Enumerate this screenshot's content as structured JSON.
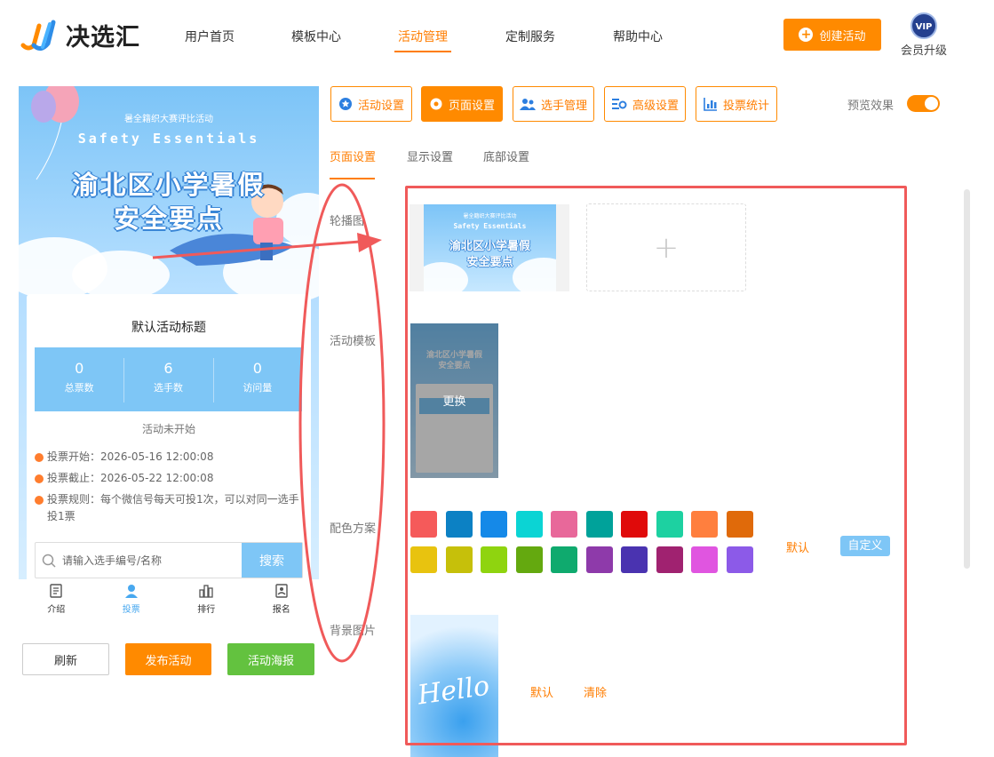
{
  "header": {
    "logo_text": "决选汇",
    "nav": [
      "用户首页",
      "模板中心",
      "活动管理",
      "定制服务",
      "帮助中心"
    ],
    "active_nav": "活动管理",
    "create_button": "创建活动",
    "vip_badge": "VIP",
    "vip_label": "会员升级"
  },
  "preview": {
    "banner_subtitle": "暑全籍织大赛评比活动",
    "banner_english": "Safety  Essentials",
    "banner_title_line1": "渝北区小学暑假",
    "banner_title_line2": "安全要点",
    "card_title": "默认活动标题",
    "stats": [
      {
        "value": "0",
        "label": "总票数"
      },
      {
        "value": "6",
        "label": "选手数"
      },
      {
        "value": "0",
        "label": "访问量"
      }
    ],
    "status": "活动未开始",
    "vote_start": "投票开始：2026-05-16 12:00:08",
    "vote_end": "投票截止：2026-05-22 12:00:08",
    "vote_rule": "投票规则：每个微信号每天可投1次，可以对同一选手投1票",
    "search_placeholder": "请输入选手编号/名称",
    "search_button": "搜索",
    "tabs": [
      {
        "label": "介绍",
        "icon": "doc-icon"
      },
      {
        "label": "投票",
        "icon": "user-icon"
      },
      {
        "label": "排行",
        "icon": "bar-chart-icon"
      },
      {
        "label": "报名",
        "icon": "form-icon"
      }
    ],
    "active_tab": "投票"
  },
  "bottom_buttons": {
    "refresh": "刷新",
    "publish": "发布活动",
    "poster": "活动海报"
  },
  "toolbar": {
    "buttons": [
      {
        "label": "活动设置",
        "icon": "star-badge-icon"
      },
      {
        "label": "页面设置",
        "icon": "gear-icon"
      },
      {
        "label": "选手管理",
        "icon": "users-icon"
      },
      {
        "label": "高级设置",
        "icon": "settings-list-icon"
      },
      {
        "label": "投票统计",
        "icon": "chart-icon"
      }
    ],
    "active": "页面设置",
    "preview_label": "预览效果",
    "preview_toggle": true
  },
  "subtabs": [
    "页面设置",
    "显示设置",
    "底部设置"
  ],
  "active_subtab": "页面设置",
  "sections": {
    "carousel_label": "轮播图",
    "template_label": "活动模板",
    "template_change": "更换",
    "color_label": "配色方案",
    "color_default": "默认",
    "color_custom": "自定义",
    "bg_label": "背景图片",
    "bg_text": "Hello",
    "bg_default": "默认",
    "bg_clear": "清除"
  },
  "colors": {
    "accent": "#ff8a00",
    "primary_blue": "#7ec6f6",
    "highlight": "#f05a5a",
    "swatches": [
      "#f55a5a",
      "#0c81c4",
      "#1589e8",
      "#0bd4d4",
      "#e8689a",
      "#00a29a",
      "#e00a0a",
      "#1dd1a1",
      "#ff7f3e",
      "#e06a0a",
      "#e8c30f",
      "#c6c00a",
      "#8fd40f",
      "#64a90f",
      "#0faa6e",
      "#8e3aaa",
      "#4a33b0",
      "#a02270",
      "#e055e0",
      "#8c5ae8"
    ]
  }
}
